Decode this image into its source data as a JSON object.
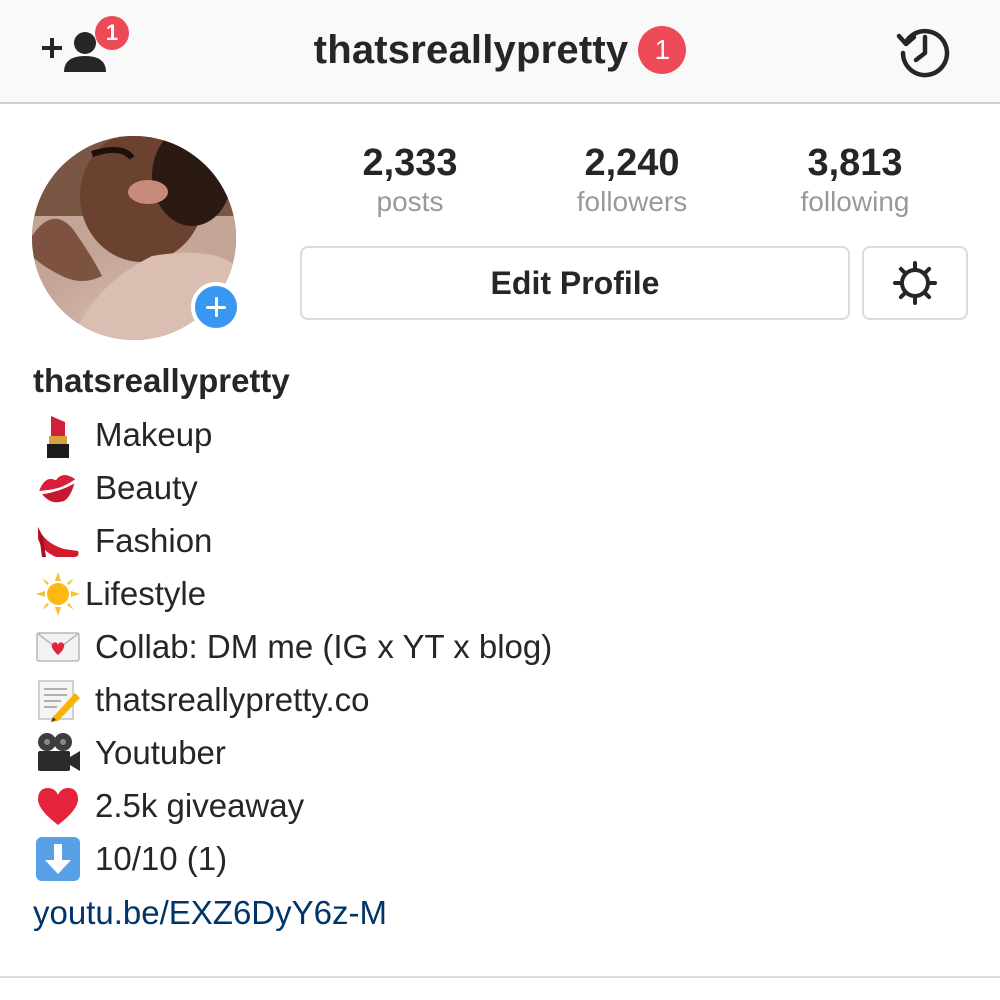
{
  "nav": {
    "add_friends_badge": "1",
    "username": "thatsreallypretty",
    "username_badge": "1"
  },
  "stats": [
    {
      "value": "2,333",
      "label": "posts"
    },
    {
      "value": "2,240",
      "label": "followers"
    },
    {
      "value": "3,813",
      "label": "following"
    }
  ],
  "actions": {
    "edit_profile_label": "Edit Profile"
  },
  "bio": {
    "name": "thatsreallypretty",
    "lines": [
      {
        "icon": "lipstick-icon",
        "text": "Makeup"
      },
      {
        "icon": "kiss-mark-icon",
        "text": "Beauty"
      },
      {
        "icon": "high-heel-icon",
        "text": "Fashion"
      },
      {
        "icon": "sun-icon",
        "text": "Lifestyle"
      },
      {
        "icon": "love-letter-icon",
        "text": "Collab: DM me (IG x YT x blog)"
      },
      {
        "icon": "memo-icon",
        "text": "thatsreallypretty.co"
      },
      {
        "icon": "movie-camera-icon",
        "text": "Youtuber"
      },
      {
        "icon": "red-heart-icon",
        "text": "2.5k giveaway"
      },
      {
        "icon": "down-arrow-icon",
        "text": "10/10 (1)"
      }
    ],
    "link": "youtu.be/EXZ6DyY6z-M"
  },
  "colors": {
    "badge": "#ed4956",
    "accent_blue": "#3897f0",
    "link": "#003569",
    "secondary_text": "#999999"
  }
}
